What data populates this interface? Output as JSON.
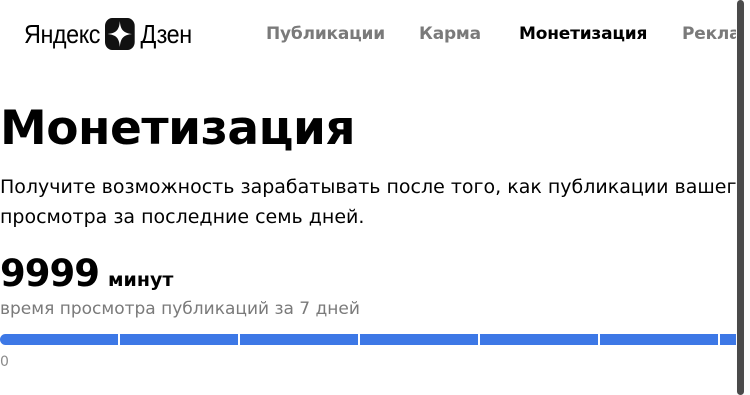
{
  "header": {
    "logo": {
      "brand": "Яндекс",
      "product": "Дзен",
      "icon": "zen-star-logo-icon"
    },
    "nav": [
      {
        "label": "Публикации",
        "active": false
      },
      {
        "label": "Карма",
        "active": false
      },
      {
        "label": "Монетизация",
        "active": true
      },
      {
        "label": "Реклама",
        "active": false
      }
    ]
  },
  "main": {
    "title": "Монетизация",
    "description": "Получите возможность зарабатывать после того, как публикации вашего канала наберут нужное время просмотра за последние семь дней.",
    "metric": {
      "value": "9999",
      "unit": "минут",
      "caption": "время просмотра публикаций за 7 дней"
    },
    "progress": {
      "min_label": "0",
      "segments": 7,
      "color": "#3d78e6"
    }
  },
  "colors": {
    "accent": "#3d78e6",
    "muted_text": "#7a7a7a"
  }
}
